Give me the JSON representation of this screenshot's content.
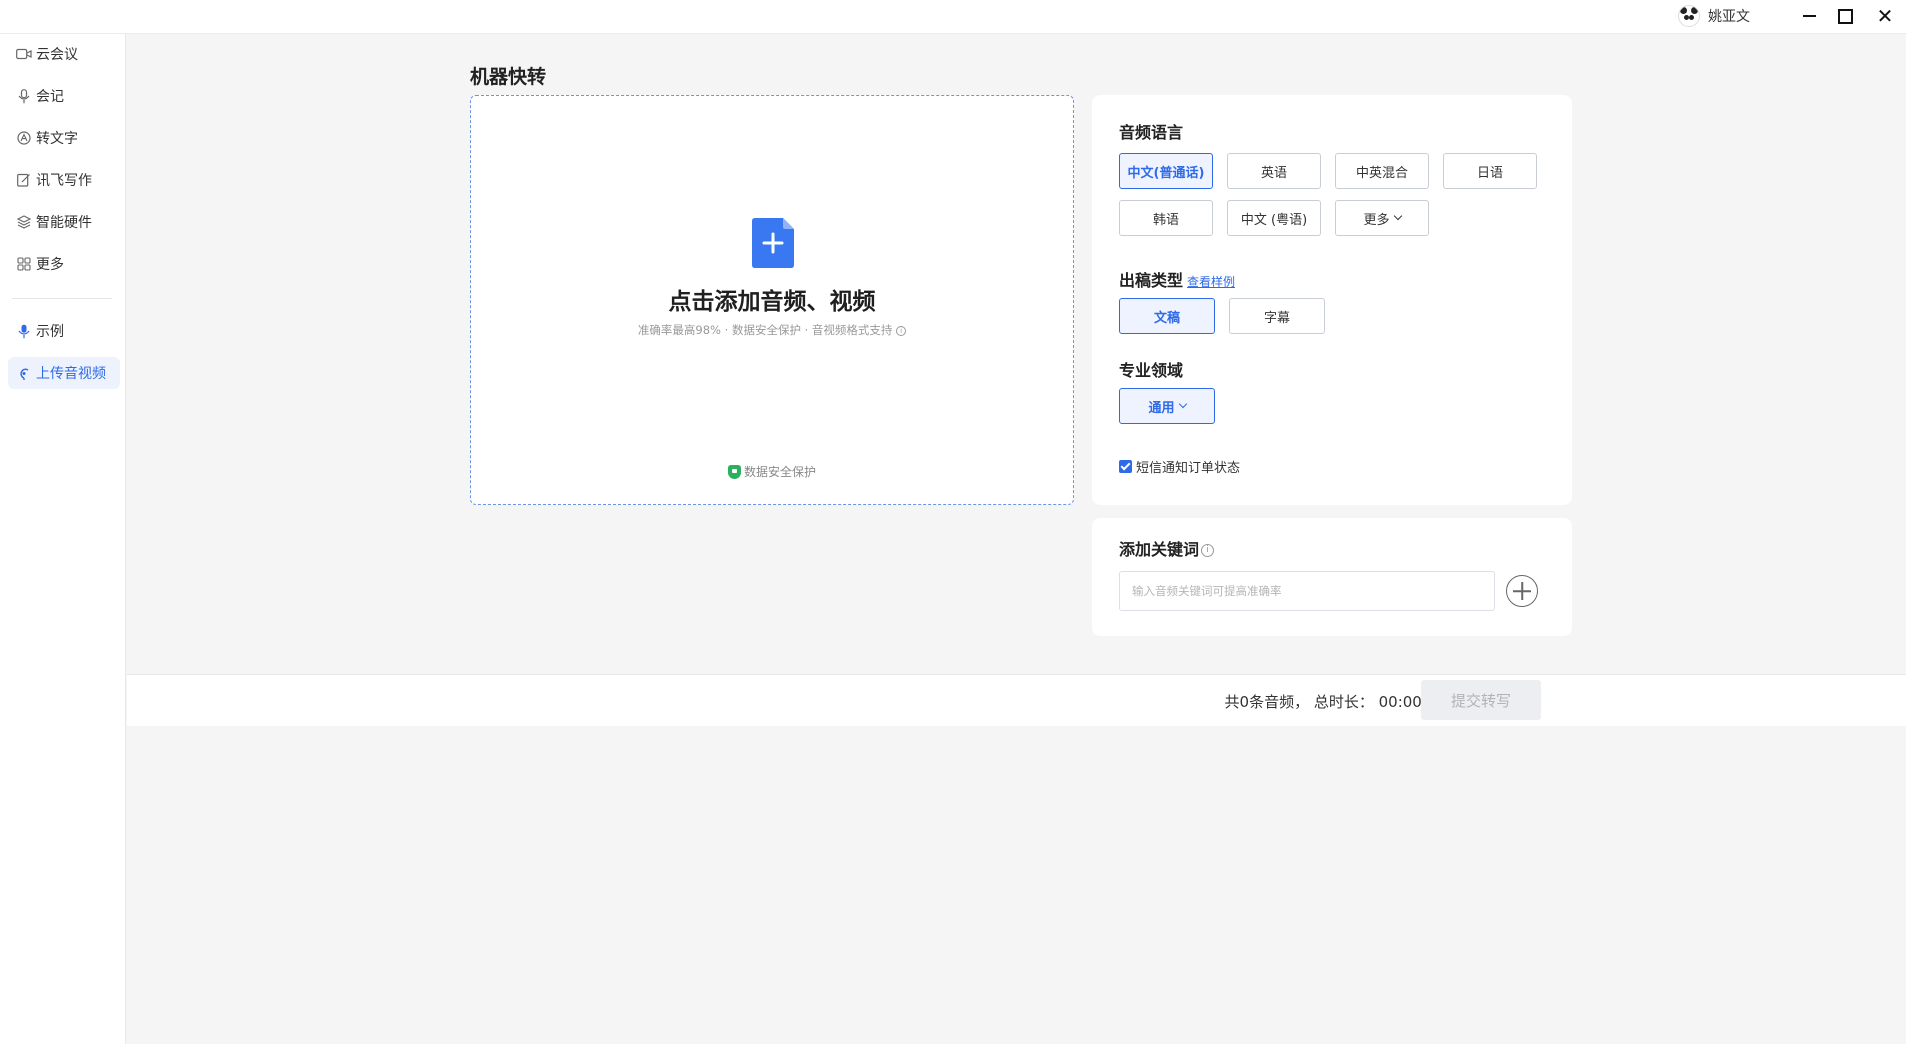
{
  "titlebar": {
    "user_name": "姚亚文"
  },
  "sidebar": {
    "items": [
      {
        "label": "云会议",
        "icon": "video-icon"
      },
      {
        "label": "会记",
        "icon": "microphone-icon"
      },
      {
        "label": "转文字",
        "icon": "transcribe-icon"
      },
      {
        "label": "讯飞写作",
        "icon": "edit-icon"
      },
      {
        "label": "智能硬件",
        "icon": "layers-icon"
      },
      {
        "label": "更多",
        "icon": "grid-icon"
      }
    ],
    "secondary": [
      {
        "label": "示例",
        "icon": "microphone-icon"
      },
      {
        "label": "上传音视频",
        "icon": "upload-audio-icon",
        "active": true
      }
    ]
  },
  "main": {
    "title": "机器快转",
    "upload": {
      "title": "点击添加音频、视频",
      "subtitle": "准确率最高98% · 数据安全保护 · 音视频格式支持",
      "security": "数据安全保护"
    }
  },
  "options": {
    "language": {
      "title": "音频语言",
      "items": [
        "中文(普通话)",
        "英语",
        "中英混合",
        "日语",
        "韩语",
        "中文 (粤语)",
        "更多"
      ],
      "selected": "中文(普通话)"
    },
    "output_type": {
      "title": "出稿类型",
      "link": "查看样例",
      "items": [
        "文稿",
        "字幕"
      ],
      "selected": "文稿"
    },
    "domain": {
      "title": "专业领域",
      "value": "通用"
    },
    "sms_notify": {
      "label": "短信通知订单状态",
      "checked": true
    }
  },
  "keywords": {
    "title": "添加关键词",
    "placeholder": "输入音频关键词可提高准确率"
  },
  "footer": {
    "summary": "共0条音频，  总时长：  00:00:00",
    "submit": "提交转写"
  },
  "colors": {
    "accent": "#2f6be8",
    "shield": "#2bb15d",
    "background": "#f5f5f6"
  }
}
